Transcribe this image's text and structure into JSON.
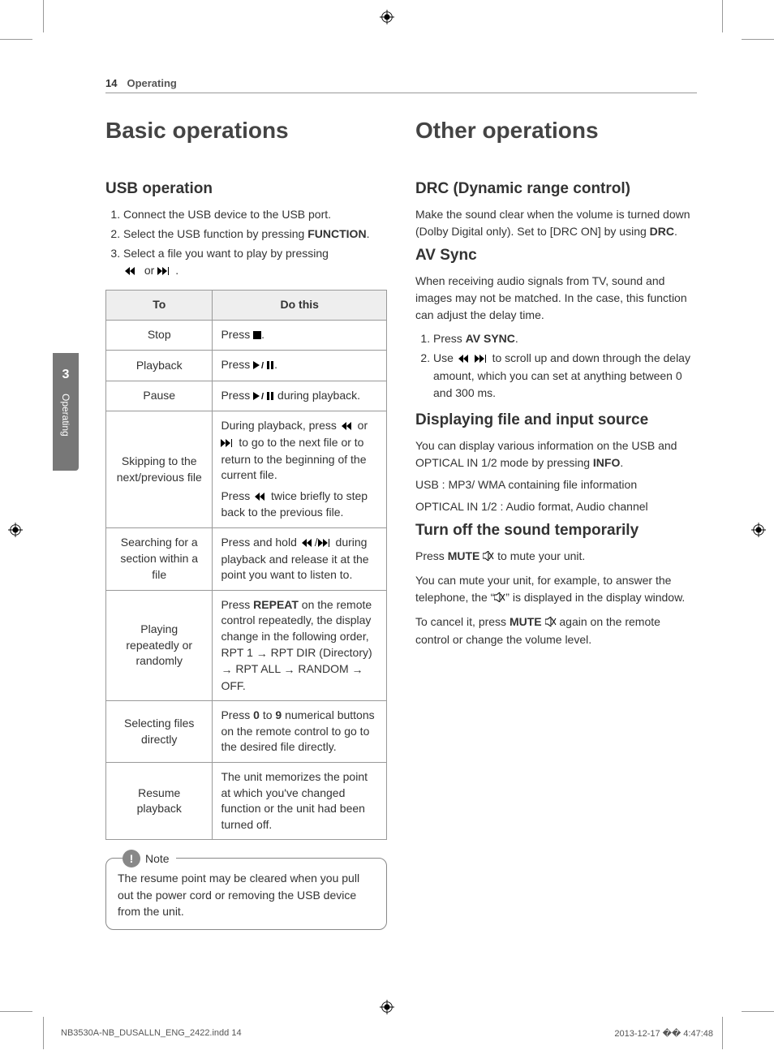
{
  "header": {
    "page_num": "14",
    "section": "Operating"
  },
  "sidetab": {
    "num": "3",
    "label": "Operating"
  },
  "left": {
    "h1": "Basic operations",
    "h2": "USB operation",
    "ol": [
      "Connect the USB device to the USB port.",
      "Select the USB function by pressing ",
      "Select a file you want to play by pressing"
    ],
    "ol2_bold": "FUNCTION",
    "ol3_tail": " or ",
    "table": {
      "th_to": "To",
      "th_do": "Do this",
      "rows": [
        {
          "to": "Stop",
          "do_pre": "Press ",
          "do_post": "."
        },
        {
          "to": "Playback",
          "do_pre": "Press ",
          "do_post": "."
        },
        {
          "to": "Pause",
          "do_pre": "Press ",
          "do_post": " during playback."
        },
        {
          "to": "Skipping to the next/previous file",
          "do_p1a": "During playback, press ",
          "do_p1b": " or ",
          "do_p1c": " to go to the next file or to return to the beginning of the current file.",
          "do_p2a": "Press ",
          "do_p2b": " twice briefly to step back to the previous file."
        },
        {
          "to": "Searching for a section within a file",
          "do_pre": "Press and hold ",
          "do_mid": "/",
          "do_post": " during playback and release it at the point you want to listen to."
        },
        {
          "to": "Playing repeatedly or randomly",
          "do_pre": "Press ",
          "do_bold": "REPEAT",
          "do_post": " on the remote control repeatedly, the display change in the following order, RPT 1 ",
          "seq2": " RPT DIR (Directory) ",
          "seq3": " RPT ALL ",
          "seq4": " RANDOM ",
          "seq5": " OFF."
        },
        {
          "to": "Selecting files directly",
          "do_pre": "Press ",
          "b1": "0",
          "mid": " to ",
          "b2": "9",
          "do_post": " numerical buttons on the remote control to go to the desired file directly."
        },
        {
          "to": "Resume playback",
          "do": "The unit memorizes the point at which you've changed function or the unit had been turned off."
        }
      ]
    },
    "note": {
      "label": "Note",
      "text": "The resume point may be cleared when you pull out the power cord or removing the USB device from the unit."
    }
  },
  "right": {
    "h1": "Other operations",
    "sec1": {
      "h2": "DRC (Dynamic range control)",
      "p": "Make the sound clear when the volume is turned down (Dolby Digital only). Set to [DRC ON] by using ",
      "bold": "DRC",
      "tail": "."
    },
    "sec2": {
      "h2": "AV Sync",
      "p": "When receiving audio signals from TV, sound and images may not be matched. In the case, this function can adjust the delay time.",
      "li1_pre": "Press ",
      "li1_bold": "AV SYNC",
      "li1_post": ".",
      "li2_pre": "Use ",
      "li2_post": " to scroll up and down through the delay amount, which you can set at anything between 0 and 300 ms."
    },
    "sec3": {
      "h2": "Displaying file and input source",
      "p1a": "You can display various information on the USB and OPTICAL IN 1/2 mode by pressing ",
      "p1b": "INFO",
      "p1c": ".",
      "p2": "USB : MP3/ WMA containing file information",
      "p3": "OPTICAL IN 1/2 : Audio format, Audio channel"
    },
    "sec4": {
      "h2": "Turn off the sound temporarily",
      "p1a": "Press ",
      "p1b": "MUTE ",
      "p1c": " to mute your unit.",
      "p2a": "You can mute your unit, for example, to answer the telephone, the “",
      "p2b": "” is displayed in the display window.",
      "p3a": "To cancel it, press ",
      "p3b": "MUTE ",
      "p3c": " again on the remote control or change the volume level."
    }
  },
  "footer": {
    "file": "NB3530A-NB_DUSALLN_ENG_2422.indd   14",
    "date": "2013-12-17   �� 4:47:48"
  }
}
